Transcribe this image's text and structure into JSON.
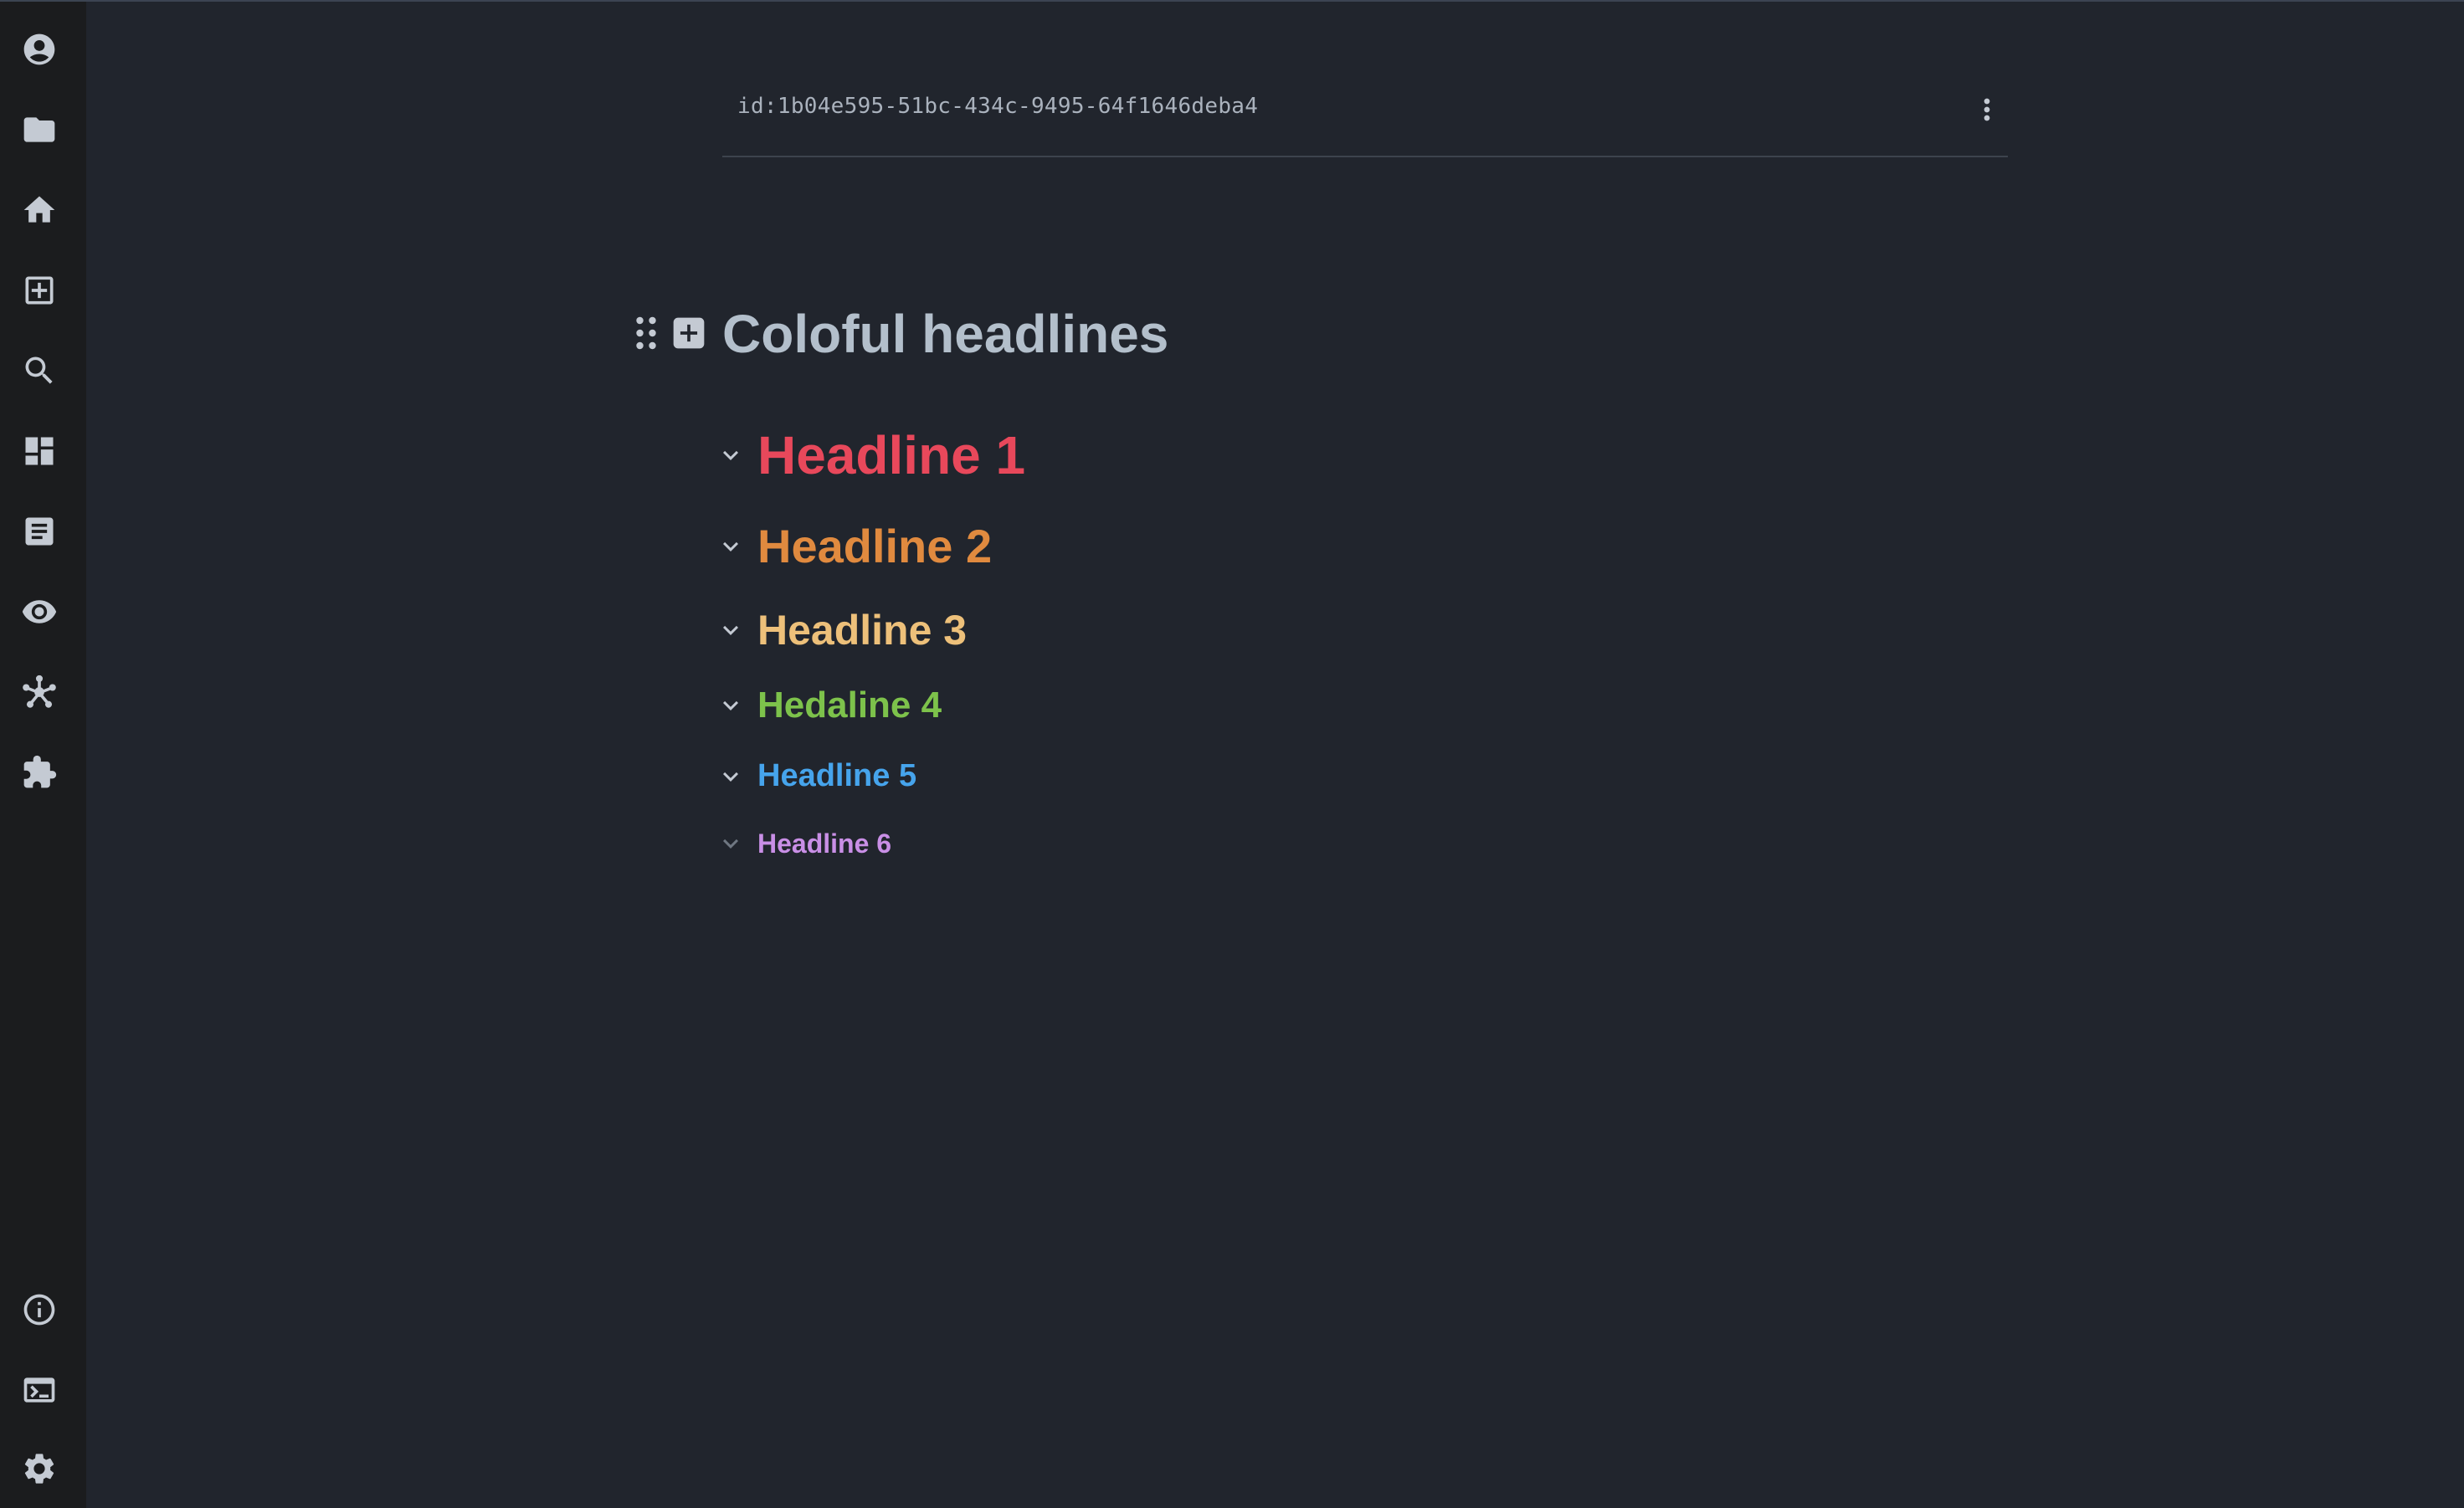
{
  "document": {
    "id_label": "id:1b04e595-51bc-434c-9495-64f1646deba4",
    "title": "Coloful headlines"
  },
  "headlines": [
    {
      "label": "Headline 1",
      "color": "#e8485b"
    },
    {
      "label": "Headline 2",
      "color": "#e08a3f"
    },
    {
      "label": "Headline 3",
      "color": "#edc07a"
    },
    {
      "label": "Hedaline 4",
      "color": "#7dc24b"
    },
    {
      "label": "Headline 5",
      "color": "#46a4ec"
    },
    {
      "label": "Headline 6",
      "color": "#c98fe6"
    }
  ],
  "sidebar": {
    "top_icons": [
      "account-icon",
      "folder-icon",
      "home-icon",
      "add-box-icon",
      "search-icon",
      "dashboard-icon",
      "document-icon",
      "eye-icon",
      "graph-icon",
      "extension-icon"
    ],
    "bottom_icons": [
      "info-icon",
      "terminal-icon",
      "settings-icon"
    ]
  },
  "colors": {
    "background": "#21252d",
    "sidebar": "#1b1c1e",
    "icon": "#c4cad3",
    "title": "#b3bfcb"
  }
}
